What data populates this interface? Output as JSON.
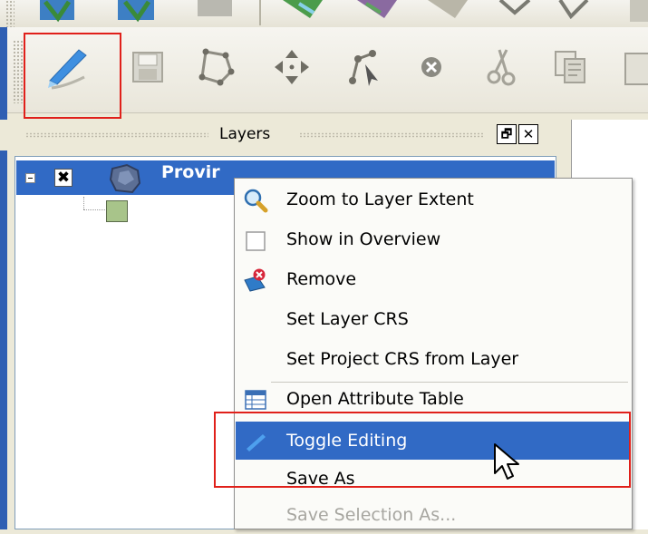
{
  "layers_panel": {
    "title": "Layers",
    "float_button": "🗗",
    "close_button": "✕",
    "layer": {
      "name": "Provir",
      "checked_glyph": "✖"
    }
  },
  "toolbar": {
    "tools": [
      {
        "name": "toggle-editing-tool",
        "icon": "pencil-icon"
      },
      {
        "name": "save-edits-tool",
        "icon": "floppy-icon"
      },
      {
        "name": "add-polygon-tool",
        "icon": "polygon-icon"
      },
      {
        "name": "move-feature-tool",
        "icon": "move-arrows-icon"
      },
      {
        "name": "node-tool",
        "icon": "node-icon"
      },
      {
        "name": "delete-selected-tool",
        "icon": "delete-icon"
      },
      {
        "name": "cut-features-tool",
        "icon": "scissors-icon"
      },
      {
        "name": "copy-features-tool",
        "icon": "copy-icon"
      }
    ]
  },
  "context_menu": {
    "items": [
      {
        "label": "Zoom to Layer Extent",
        "icon": "zoom-layer-icon",
        "state": "normal"
      },
      {
        "label": "Show in Overview",
        "icon": "overview-checkbox-icon",
        "state": "normal"
      },
      {
        "label": "Remove",
        "icon": "remove-layer-icon",
        "state": "normal"
      },
      {
        "label": "Set Layer CRS",
        "icon": "",
        "state": "normal"
      },
      {
        "label": "Set Project CRS from Layer",
        "icon": "",
        "state": "normal"
      },
      {
        "label": "Open Attribute Table",
        "icon": "attribute-table-icon",
        "state": "normal"
      },
      {
        "label": "Toggle Editing",
        "icon": "pencil-icon",
        "state": "highlighted"
      },
      {
        "label": "Save As",
        "icon": "",
        "state": "normal"
      },
      {
        "label": "Save Selection As...",
        "icon": "",
        "state": "disabled"
      }
    ]
  },
  "colors": {
    "highlight": "#316ac5",
    "callout_box": "#e0201a"
  }
}
